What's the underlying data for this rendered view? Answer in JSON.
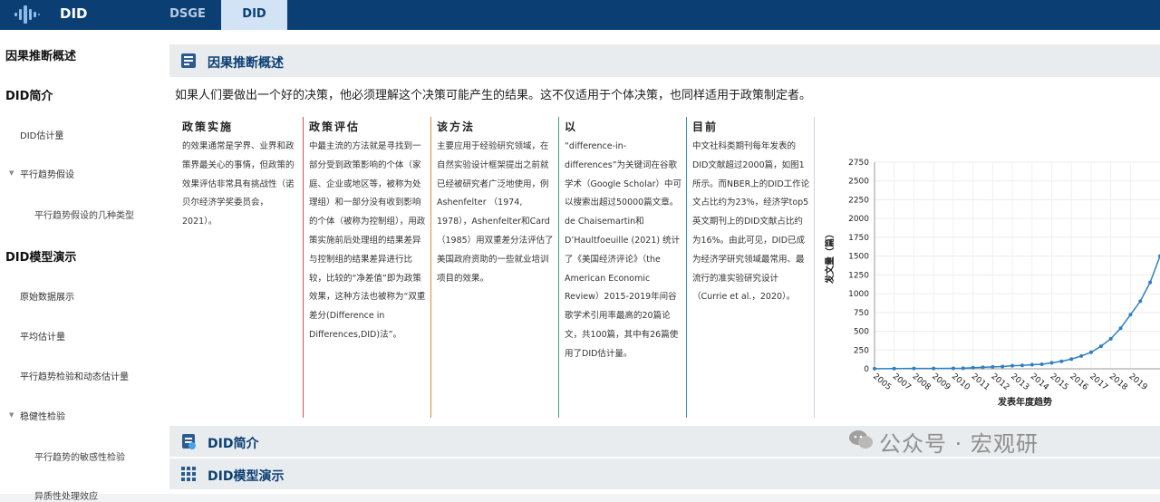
{
  "app": {
    "title": "DID"
  },
  "tabs": [
    {
      "label": "DSGE"
    },
    {
      "label": "DID"
    }
  ],
  "sidebar": {
    "items": [
      {
        "label": "因果推断概述"
      },
      {
        "label": "DID简介"
      },
      {
        "label": "DID估计量"
      },
      {
        "label": "平行趋势假设"
      },
      {
        "label": "平行趋势假设的几种类型"
      },
      {
        "label": "DID模型演示"
      },
      {
        "label": "原始数据展示"
      },
      {
        "label": "平均估计量"
      },
      {
        "label": "平行趋势检验和动态估计量"
      },
      {
        "label": "稳健性检验"
      },
      {
        "label": "平行趋势的敏感性检验"
      },
      {
        "label": "异质性处理效应"
      }
    ]
  },
  "main": {
    "section1_title": "因果推断概述",
    "intro": "如果人们要做出一个好的决策，他必须理解这个决策可能产生的结果。这不仅适用于个体决策，也同样适用于政策制定者。",
    "columns": [
      {
        "title": "政策实施",
        "text": "的效果通常是学界、业界和政策界最关心的事情，但政策的效果评估非常具有挑战性（诺贝尔经济学奖委员会，2021）。"
      },
      {
        "title": "政策评估",
        "text": "中最主流的方法就是寻找到一部分受到政策影响的个体（家庭、企业或地区等，被称为处理组）和一部分没有收到影响的个体（被称为控制组），用政策实施前后处理组的结果差异与控制组的结果差异进行比较，比较的“净差值”即为政策效果，这种方法也被称为“双重差分(Difference in Differences,DID)法”。"
      },
      {
        "title": "该方法",
        "text": "主要应用于经验研究领域，在自然实验设计框架提出之前就已经被研究者广泛地使用，例 Ashenfelter （1974, 1978），Ashenfelter和Card（1985）用双重差分法评估了美国政府资助的一些就业培训项目的效果。"
      },
      {
        "title": "以",
        "text": "“difference-in-differences”为关键词在谷歌学术（Google Scholar）中可以搜索出超过50000篇文章。de Chaisemartin和D’Haultfoeuille (2021) 统计了《美国经济评论》（the American Economic Review）2015-2019年间谷歌学术引用率最高的20篇论文，共100篇，其中有26篇使用了DID估计量。"
      },
      {
        "title": "目前",
        "text": "中文社科类期刊每年发表的DID文献超过2000篇，如图1所示。而NBER上的DID工作论文占比约为23%，经济学top5英文期刊上的DID文献占比约为16%。由此可见，DID已成为经济学研究领域最常用、最流行的准实验研究设计（Currie et al.，2020）。"
      }
    ],
    "section2_title": "DID简介",
    "section3_title": "DID模型演示",
    "watermark": "公众号 · 宏观研"
  },
  "chart_data": {
    "type": "line",
    "xlabel": "发表年度趋势",
    "ylabel": "发文量（篇）",
    "ylim": [
      0,
      2750
    ],
    "yticks": [
      0,
      250,
      500,
      750,
      1000,
      1250,
      1500,
      1750,
      2000,
      2250,
      2500,
      2750
    ],
    "x": [
      "2005",
      "2007",
      "2008",
      "2009",
      "2010",
      "2011",
      "2012",
      "2013",
      "2014",
      "2015",
      "2016",
      "2017",
      "2018",
      "2019"
    ],
    "series": [
      {
        "x": [
          2005,
          2006,
          2007,
          2008,
          2009,
          2009.5,
          2010,
          2010.5,
          2011,
          2011.5,
          2012,
          2012.5,
          2013,
          2013.5,
          2014,
          2014.5,
          2015,
          2015.5,
          2016,
          2016.5,
          2017,
          2017.5,
          2018,
          2018.5,
          2019,
          2019.5
        ],
        "values": [
          2,
          3,
          4,
          5,
          6,
          8,
          15,
          20,
          25,
          30,
          40,
          45,
          55,
          60,
          80,
          100,
          130,
          170,
          220,
          300,
          400,
          540,
          720,
          900,
          1150,
          1500
        ]
      }
    ],
    "line_color": "#2f7fc1",
    "grid": true
  }
}
